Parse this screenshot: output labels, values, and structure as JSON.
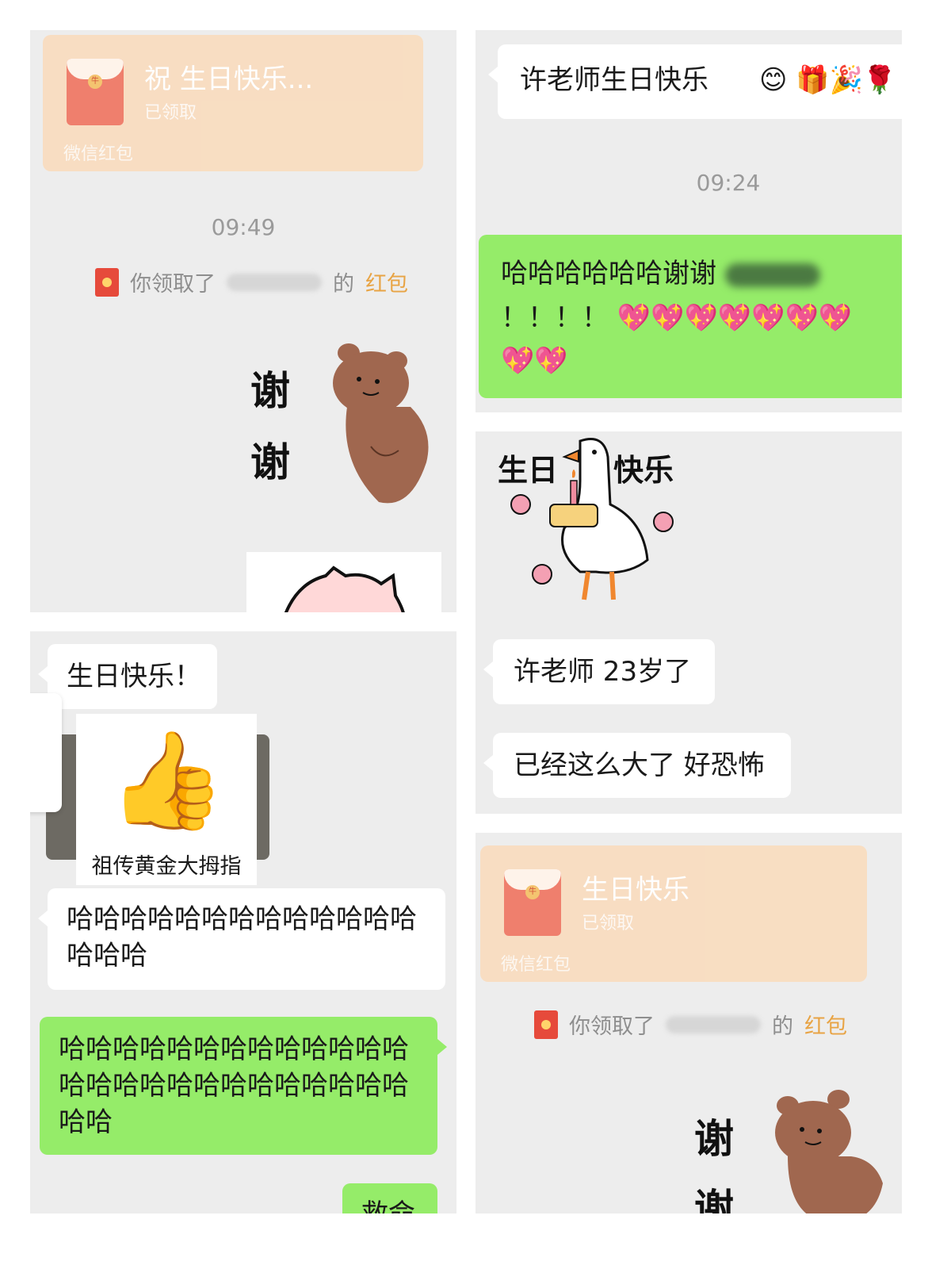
{
  "panel1": {
    "redpacket": {
      "title": "祝 生日快乐...",
      "status": "已领取",
      "footer": "微信红包",
      "seal": "牛"
    },
    "time": "09:49",
    "system": {
      "prefix": "你领取了",
      "suffix": "的",
      "link": "红包"
    },
    "sticker_text": [
      "谢",
      "谢"
    ]
  },
  "panel2": {
    "message": "许老师生日快乐",
    "emojis": "😊 🎁🎉🌹",
    "time": "09:24",
    "green_message_line1": "哈哈哈哈哈哈谢谢",
    "green_message_line2": "！！！！",
    "hearts": "💖💖💖💖💖💖💖",
    "hearts_line2": "💖💖"
  },
  "panel3": {
    "message1": "生日快乐！",
    "sticker_caption": "祖传黄金大拇指",
    "message2": "哈哈哈哈哈哈哈哈哈哈哈哈哈哈哈哈",
    "green_message": "哈哈哈哈哈哈哈哈哈哈哈哈哈哈哈哈哈哈哈哈哈哈哈哈哈哈哈哈",
    "partial": "救命"
  },
  "panel4": {
    "sticker_text_left": "生日",
    "sticker_text_right": "快乐",
    "message1": "许老师 23岁了",
    "message2": "已经这么大了 好恐怖"
  },
  "panel5": {
    "redpacket": {
      "title": "生日快乐",
      "status": "已领取",
      "footer": "微信红包",
      "seal": "牛"
    },
    "system": {
      "prefix": "你领取了",
      "suffix": "的",
      "link": "红包"
    },
    "sticker_text": [
      "谢",
      "谢"
    ]
  },
  "colors": {
    "chat_bg": "#ededed",
    "green_bubble": "#95ec69",
    "redpacket": "#f9ddc0",
    "envelope": "#f07a67",
    "link": "#e8a445"
  }
}
